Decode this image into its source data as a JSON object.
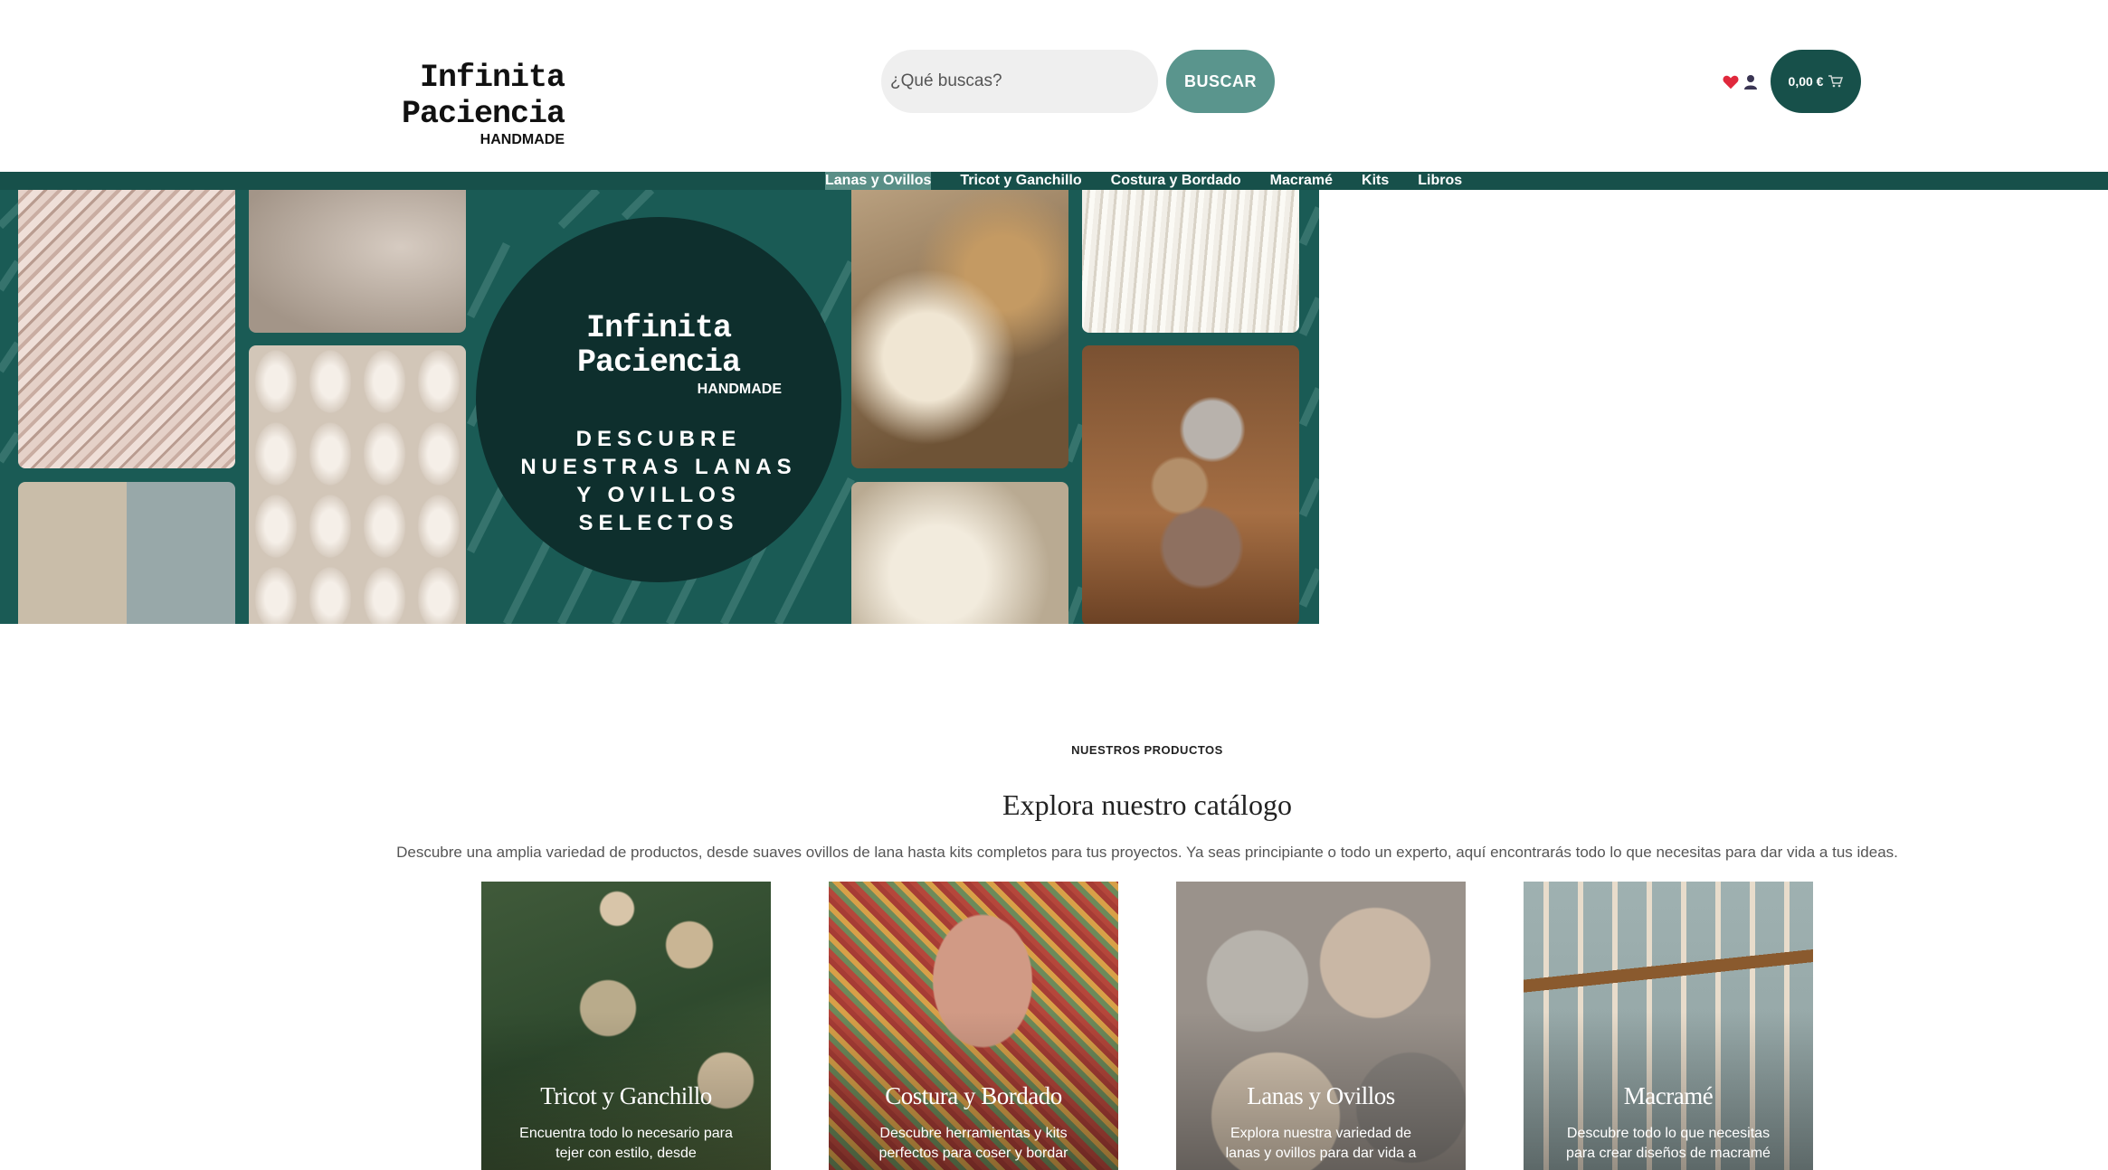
{
  "header": {
    "logo_title": "Infinita Paciencia",
    "logo_sub": "HANDMADE",
    "search_placeholder": "¿Qué buscas?",
    "search_button": "BUSCAR",
    "cart_total": "0,00 €",
    "icons": [
      "heart-icon",
      "user-icon",
      "cart-icon"
    ]
  },
  "nav": {
    "items": [
      "Lanas y Ovillos",
      "Tricot y Ganchillo",
      "Costura y Bordado",
      "Macramé",
      "Kits",
      "Libros"
    ]
  },
  "hero": {
    "logo_title": "Infinita Paciencia",
    "logo_sub": "HANDMADE",
    "tagline": "DESCUBRE\nNUESTRAS LANAS\nY OVILLOS\nSELECTOS"
  },
  "products": {
    "eyebrow": "NUESTROS PRODUCTOS",
    "title": "Explora nuestro catálogo",
    "description": "Descubre una amplia variedad de productos, desde suaves ovillos de lana hasta kits completos para tus proyectos. Ya seas principiante o todo un experto, aquí encontrarás todo lo que necesitas para dar vida a tus ideas.",
    "cards": [
      {
        "title": "Tricot y Ganchillo",
        "desc": "Encuentra todo lo necesario para tejer con estilo, desde"
      },
      {
        "title": "Costura y Bordado",
        "desc": "Descubre herramientas y kits perfectos para coser y bordar"
      },
      {
        "title": "Lanas y Ovillos",
        "desc": "Explora nuestra variedad de lanas y ovillos para dar vida a"
      },
      {
        "title": "Macramé",
        "desc": "Descubre todo lo que necesitas para crear diseños de macramé"
      }
    ]
  },
  "colors": {
    "brand_dark": "#17504a",
    "brand_accent": "#5a958d",
    "hero_circle": "#0e2f2d"
  }
}
